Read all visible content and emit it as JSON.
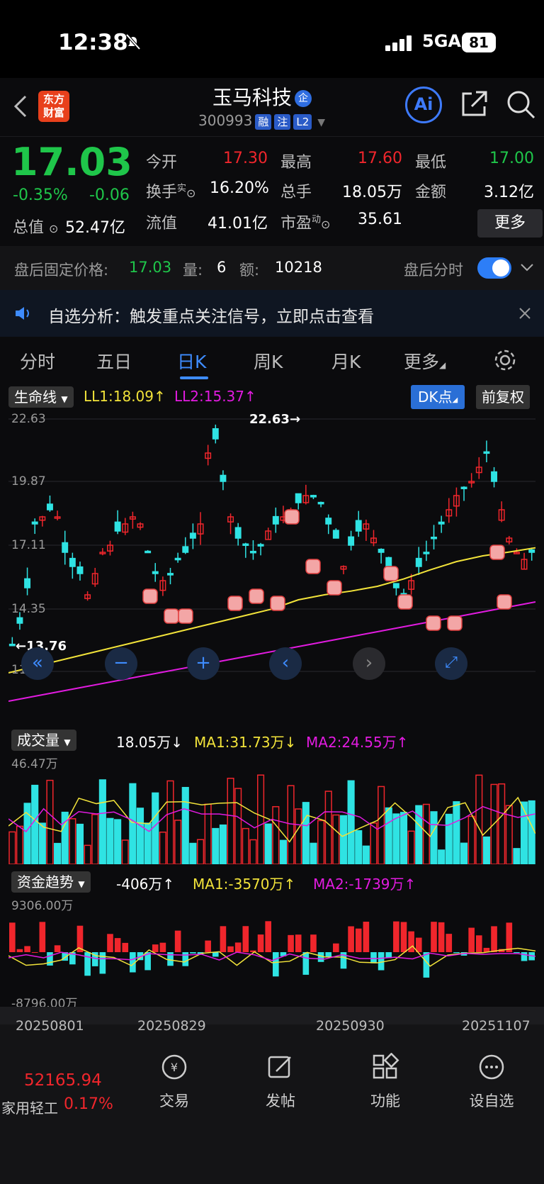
{
  "status": {
    "time": "12:38",
    "network": "5GA",
    "battery": "81"
  },
  "header": {
    "title": "玉马科技",
    "title_badge": "企",
    "code": "300993",
    "tags": [
      "融",
      "注",
      "L2"
    ],
    "logo_line1": "东方",
    "logo_line2": "财富",
    "ai_label": "Ai"
  },
  "quote": {
    "price": "17.03",
    "change_pct": "-0.35%",
    "change": "-0.06",
    "open_label": "今开",
    "open": "17.30",
    "high_label": "最高",
    "high": "17.60",
    "low_label": "最低",
    "low": "17.00",
    "turnover_label": "换手",
    "turnover_sup": "实",
    "turnover": "16.20%",
    "volume_label": "总手",
    "volume": "18.05万",
    "amount_label": "金额",
    "amount": "3.12亿",
    "mcap_label": "总值",
    "mcap": "52.47亿",
    "float_label": "流值",
    "float": "41.01亿",
    "pe_label": "市盈",
    "pe_sup": "动",
    "pe": "35.61",
    "more": "更多"
  },
  "after_hours": {
    "label": "盘后固定价格:",
    "price": "17.03",
    "vol_label": "量:",
    "vol": "6",
    "amt_label": "额:",
    "amt": "10218",
    "toggle_label": "盘后分时",
    "toggle_on": true
  },
  "notice": {
    "text": "自选分析：触发重点关注信号，立即点击查看"
  },
  "tabs": [
    "分时",
    "五日",
    "日K",
    "周K",
    "月K",
    "更多"
  ],
  "active_tab": "日K",
  "kline": {
    "indicator": "生命线",
    "ll1": "LL1:18.09",
    "ll2": "LL2:15.37",
    "dk_button": "DK点",
    "adjust_button": "前复权",
    "axis_top": "22.63",
    "axis_mid1": "19.87",
    "axis_mid2": "17.11",
    "axis_mid3": "14.35",
    "axis_bottom": "11.58",
    "max_label": "22.63",
    "min_label": "13.76",
    "colors": {
      "up": "#f0262c",
      "down": "#2fe3e3",
      "ll1": "#f2e33a",
      "ll2": "#e21be0"
    }
  },
  "volume": {
    "indicator": "成交量",
    "value": "18.05万",
    "ma1": "MA1:31.73万",
    "ma2": "MA2:24.55万",
    "axis_top": "46.47万"
  },
  "fund": {
    "indicator": "资金趋势",
    "value": "-406万",
    "ma1": "MA1:-3570万",
    "ma2": "MA2:-1739万",
    "axis_top": "9306.00万",
    "axis_bottom": "-8796.00万"
  },
  "dates": [
    "20250801",
    "20250829",
    "20250930",
    "20251107"
  ],
  "bottom": {
    "index_value": "52165.94",
    "index_name": "家用轻工",
    "index_change": "0.17%",
    "items": [
      "交易",
      "发帖",
      "功能",
      "设自选"
    ]
  }
}
